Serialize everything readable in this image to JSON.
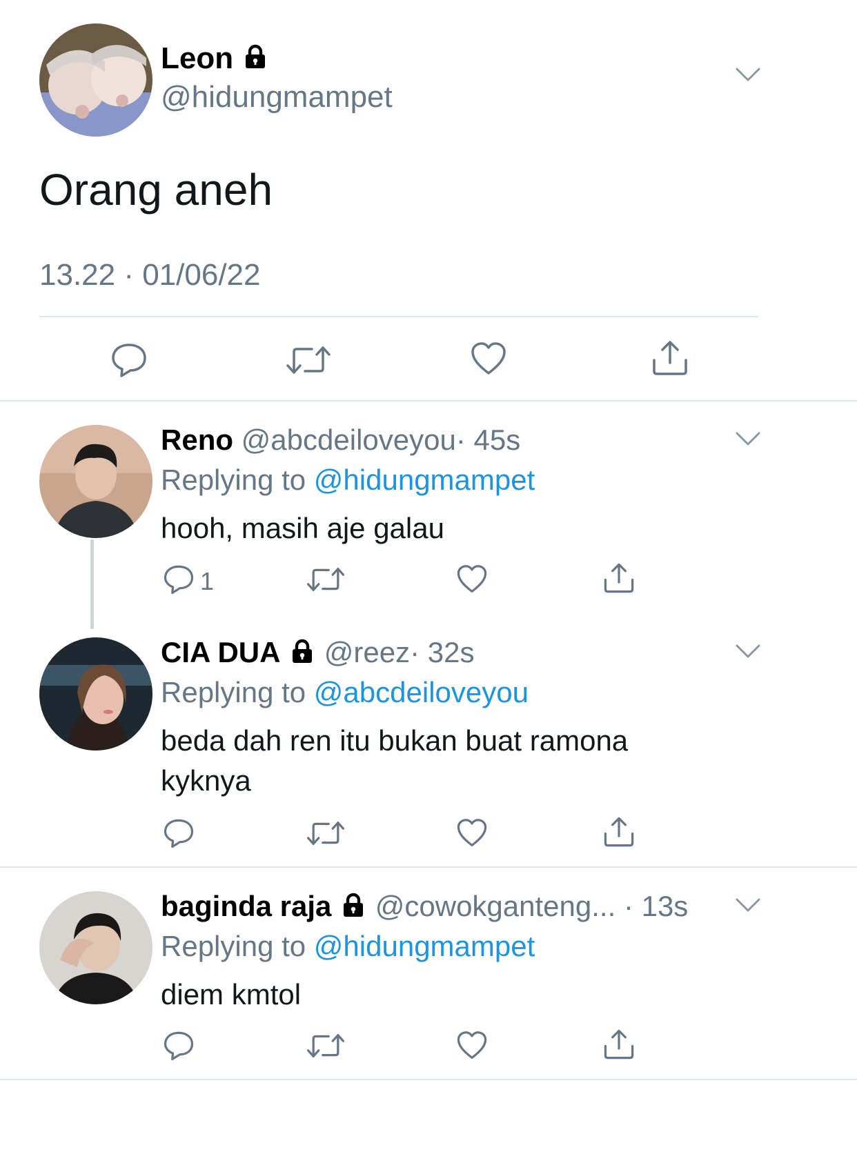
{
  "main_tweet": {
    "display_name": "Leon",
    "handle": "@hidungmampet",
    "text": "Orang aneh",
    "timestamp": "13.22 · 01/06/22"
  },
  "replies": [
    {
      "display_name": "Reno",
      "handle": "@abcdeiloveyou",
      "time": "· 45s",
      "replying_prefix": "Replying to",
      "replying_to": "@hidungmampet",
      "text_lines": [
        "hooh, masih aje galau"
      ],
      "reply_count": "1"
    },
    {
      "display_name": "CIA DUA",
      "handle": "@reez",
      "time": "· 32s",
      "replying_prefix": "Replying to",
      "replying_to": "@abcdeiloveyou",
      "text_lines": [
        "beda dah ren itu bukan buat ramona",
        "kyknya"
      ]
    },
    {
      "display_name": "baginda raja",
      "handle": "@cowokganteng...",
      "time": "· 13s",
      "replying_prefix": "Replying to",
      "replying_to": "@hidungmampet",
      "text_lines": [
        "diem kmtol"
      ]
    }
  ],
  "icons": {
    "reply": "reply-icon",
    "retweet": "retweet-icon",
    "like": "like-icon",
    "share": "share-icon",
    "more": "chevron-down-icon",
    "lock": "lock-icon"
  },
  "colors": {
    "accent": "#1b95e0",
    "muted": "#657786",
    "divider": "#e1e8ed"
  }
}
